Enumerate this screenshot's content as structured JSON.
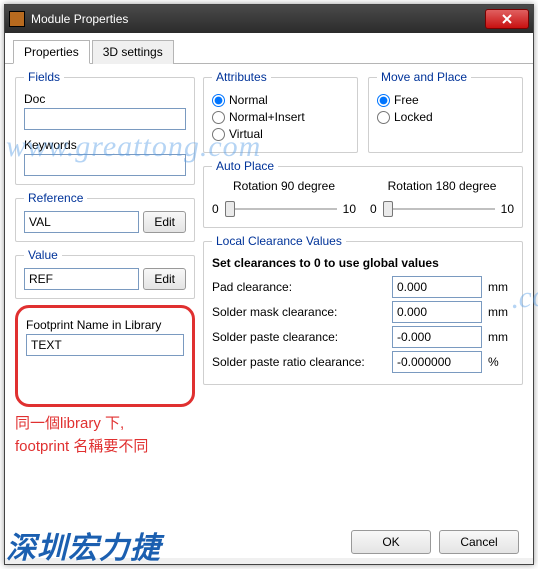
{
  "window": {
    "title": "Module Properties"
  },
  "tabs": {
    "properties": "Properties",
    "threeD": "3D settings"
  },
  "fields": {
    "legend": "Fields",
    "doc_label": "Doc",
    "doc_value": "",
    "keywords_label": "Keywords",
    "keywords_value": "",
    "reference_label": "Reference",
    "reference_value": "VAL",
    "value_label": "Value",
    "value_value": "REF",
    "edit_label": "Edit"
  },
  "footprint": {
    "label": "Footprint Name in Library",
    "value": "TEXT"
  },
  "attributes": {
    "legend": "Attributes",
    "normal": "Normal",
    "normal_insert": "Normal+Insert",
    "virtual": "Virtual"
  },
  "move_place": {
    "legend": "Move and Place",
    "free": "Free",
    "locked": "Locked"
  },
  "autoplace": {
    "legend": "Auto Place",
    "rot90": "Rotation 90 degree",
    "rot180": "Rotation 180 degree",
    "min": "0",
    "max": "10"
  },
  "clearance": {
    "legend": "Local Clearance Values",
    "note": "Set clearances to 0 to use global values",
    "pad_label": "Pad clearance:",
    "pad_value": "0.000",
    "mask_label": "Solder mask clearance:",
    "mask_value": "0.000",
    "paste_label": "Solder paste clearance:",
    "paste_value": "-0.000",
    "ratio_label": "Solder paste ratio clearance:",
    "ratio_value": "-0.000000",
    "mm": "mm",
    "pct": "%"
  },
  "buttons": {
    "ok": "OK",
    "cancel": "Cancel"
  },
  "annotation": {
    "line1": "同一個library 下,",
    "line2": "footprint 名稱要不同"
  },
  "watermark": {
    "domain": "www.greattong.com",
    "brand": "深圳宏力捷"
  }
}
